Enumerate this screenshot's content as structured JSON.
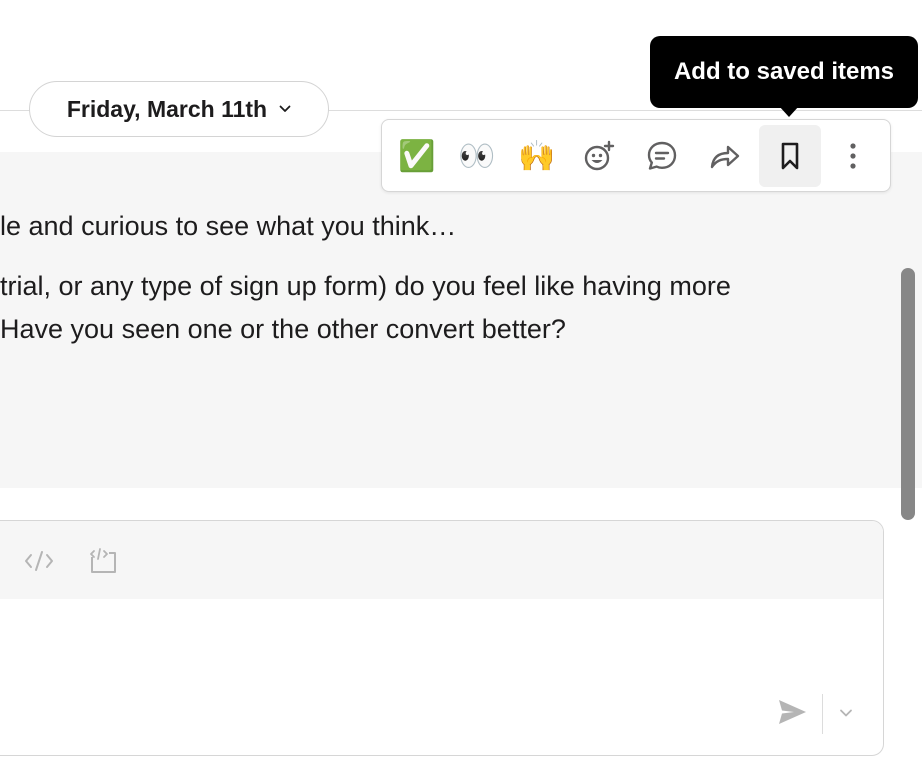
{
  "date_divider": {
    "label": "Friday, March 11th"
  },
  "message": {
    "lines": [
      "le and curious to see what you think…",
      " trial, or any type of sign up form) do you feel like having more",
      "Have you seen one or the other convert better?"
    ]
  },
  "message_actions": {
    "reactions": [
      "✅",
      "👀",
      "🙌"
    ],
    "icons": [
      "add-reaction-icon",
      "reply-in-thread-icon",
      "share-icon",
      "bookmark-icon",
      "more-actions-icon"
    ]
  },
  "tooltip": {
    "text": "Add to saved items"
  },
  "composer": {
    "format_icons": [
      "code-icon",
      "code-block-icon"
    ],
    "icons": [
      "send-icon",
      "chevron-down-icon"
    ]
  },
  "colors": {
    "tooltip_bg": "#000000",
    "message_bg": "#f6f6f6",
    "icon_gray": "#616061",
    "muted_gray": "#b5b5b5"
  }
}
